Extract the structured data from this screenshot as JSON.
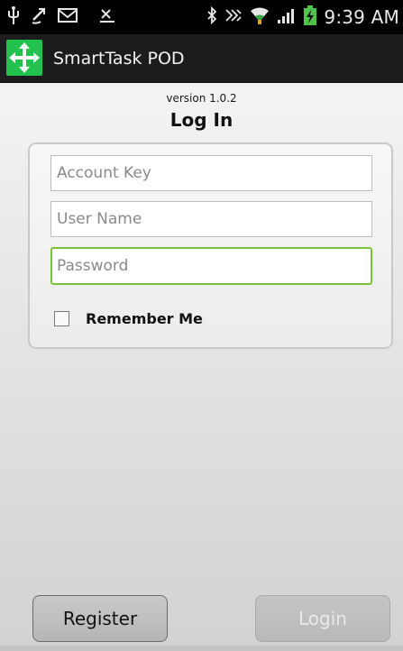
{
  "status_bar": {
    "time": "9:39 AM",
    "icons_left": [
      "usb-icon",
      "sync-icon",
      "gmail-icon",
      "missed-call-icon"
    ],
    "icons_right": [
      "bluetooth-icon",
      "nfc-icon",
      "wifi-icon",
      "signal-icon",
      "battery-charging-icon"
    ]
  },
  "action_bar": {
    "title": "SmartTask POD",
    "logo_icon": "smarttask-logo-icon",
    "logo_color": "#22c24e"
  },
  "login": {
    "version": "version 1.0.2",
    "title": "Log In",
    "account_key_placeholder": "Account Key",
    "account_key_value": "",
    "user_name_placeholder": "User Name",
    "user_name_value": "",
    "password_placeholder": "Password",
    "password_value": "",
    "remember_label": "Remember Me",
    "remember_checked": false
  },
  "buttons": {
    "register": "Register",
    "login": "Login"
  },
  "colors": {
    "focus_border": "#7cc23a",
    "cursor": "#3f8ee0",
    "disabled_text": "#e9e9e9"
  }
}
